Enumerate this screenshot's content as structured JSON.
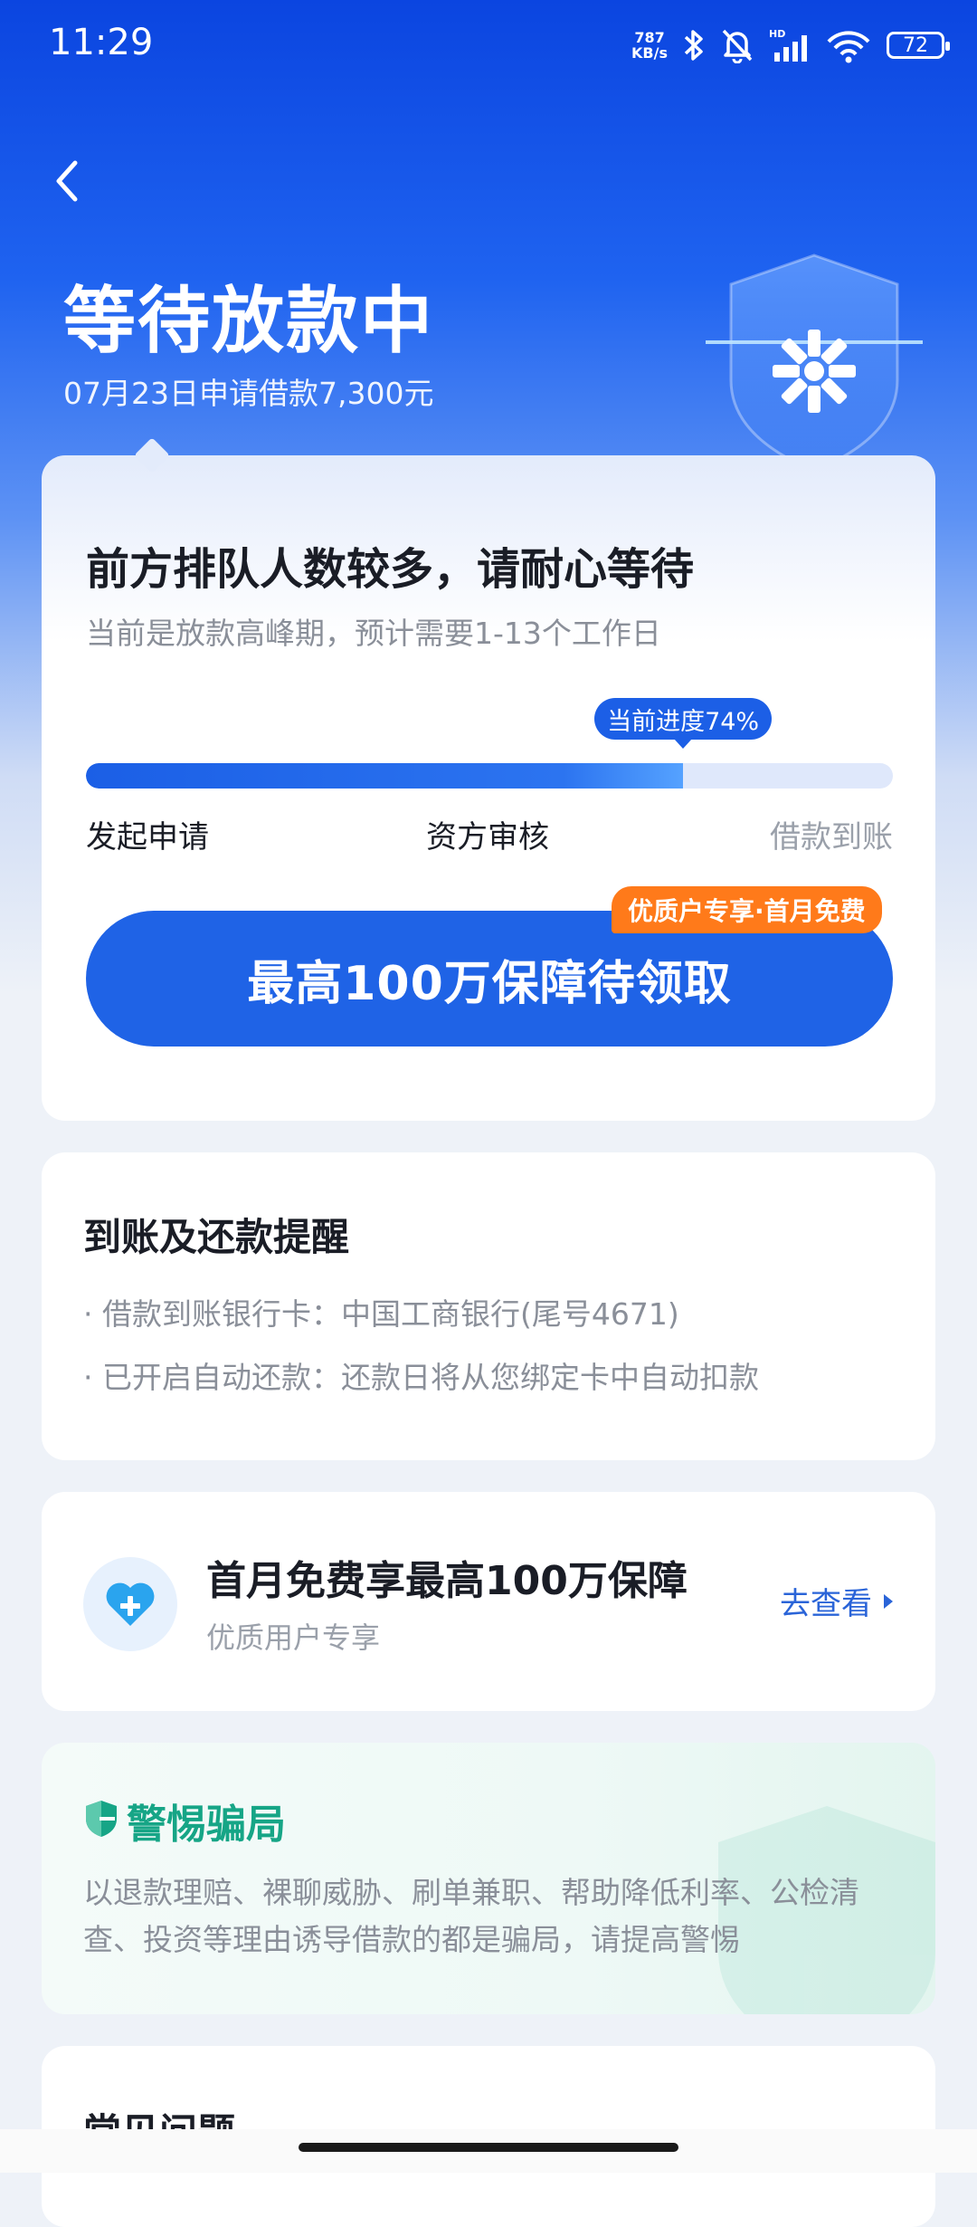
{
  "status_bar": {
    "time": "11:29",
    "net_speed_value": "787",
    "net_speed_unit": "KB/s",
    "battery": "72"
  },
  "header": {
    "title": "等待放款中",
    "subtitle": "07月23日申请借款7,300元"
  },
  "progress_card": {
    "title": "前方排队人数较多，请耐心等待",
    "description": "当前是放款高峰期，预计需要1-13个工作日",
    "progress_label": "当前进度74%",
    "progress_fraction": 0.74,
    "steps": [
      "发起申请",
      "资方审核",
      "借款到账"
    ],
    "cta_label": "最高100万保障待领取",
    "cta_badge": "优质户专享·首月免费"
  },
  "reminder_card": {
    "title": "到账及还款提醒",
    "lines": [
      "· 借款到账银行卡：中国工商银行(尾号4671)",
      "· 已开启自动还款：还款日将从您绑定卡中自动扣款"
    ]
  },
  "promo_card": {
    "title": "首月免费享最高100万保障",
    "subtitle": "优质用户专享",
    "link_label": "去查看"
  },
  "fraud_card": {
    "title": "警惕骗局",
    "text": "以退款理赔、裸聊威胁、刷单兼职、帮助降低利率、公检清查、投资等理由诱导借款的都是骗局，请提高警惕"
  },
  "faq_card": {
    "title": "常见问题"
  },
  "colors": {
    "brand_blue": "#1f63e6",
    "promo_orange": "#ff7a1a",
    "safe_green": "#16a586"
  }
}
